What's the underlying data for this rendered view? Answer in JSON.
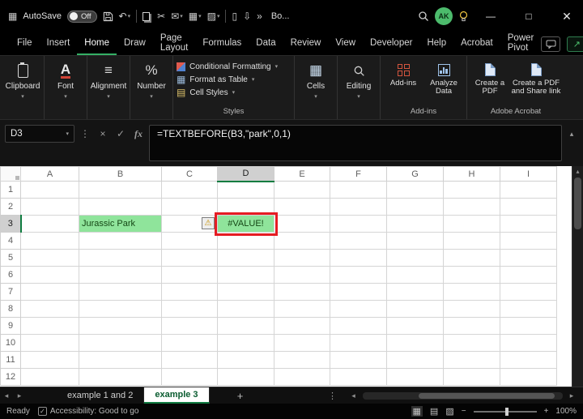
{
  "icons": {
    "chevron_down": "▾",
    "chevron_up": "▴",
    "menu_grid": "▦",
    "undo": "↶",
    "cut": "✂",
    "mail": "✉",
    "table": "▦",
    "fill": "▨",
    "doc": "▯",
    "download": "⇩",
    "overflow": "»",
    "ellipsis_v": "⋮",
    "cancel": "×",
    "check": "✓",
    "fx": "fx",
    "warning": "⚠",
    "alignment": "≡",
    "percent": "%",
    "font_a": "A",
    "cellstyles": "▤",
    "cells": "▦",
    "plus": "+",
    "minus": "−",
    "left_arrow": "◂",
    "right_arrow": "▸",
    "up_arrow": "▴",
    "view_normal": "▦",
    "view_layout": "▤",
    "view_break": "▨",
    "share_arrow": "↗",
    "minimize": "—",
    "maximize": "□",
    "close": "✕"
  },
  "titlebar": {
    "autosave_label": "AutoSave",
    "autosave_state": "Off",
    "workbook_name": "Bo...",
    "avatar_initials": "AK"
  },
  "menubar": {
    "items": [
      "File",
      "Insert",
      "Home",
      "Draw",
      "Page Layout",
      "Formulas",
      "Data",
      "Review",
      "View",
      "Developer",
      "Help",
      "Acrobat",
      "Power Pivot"
    ],
    "active": "Home"
  },
  "ribbon": {
    "collapsed_groups": [
      {
        "label": "Clipboard"
      },
      {
        "label": "Font"
      },
      {
        "label": "Alignment"
      },
      {
        "label": "Number"
      }
    ],
    "styles_group": {
      "label": "Styles",
      "items": [
        "Conditional Formatting",
        "Format as Table",
        "Cell Styles"
      ]
    },
    "cells_group": {
      "label": "Cells"
    },
    "editing_group": {
      "label": "Editing"
    },
    "addins_group": {
      "label": "Add-ins",
      "buttons": [
        "Add-ins",
        "Analyze Data"
      ]
    },
    "acrobat_group": {
      "label": "Adobe Acrobat",
      "buttons": [
        "Create a PDF",
        "Create a PDF and Share link"
      ]
    }
  },
  "formula_bar": {
    "name_box": "D3",
    "formula": "=TEXTBEFORE(B3,\"park\",0,1)"
  },
  "grid": {
    "columns": [
      "A",
      "B",
      "C",
      "D",
      "E",
      "F",
      "G",
      "H",
      "I"
    ],
    "rows": [
      "1",
      "2",
      "3",
      "4",
      "5",
      "6",
      "7",
      "8",
      "9",
      "10",
      "11",
      "12"
    ],
    "cells": {
      "B3": "Jurassic Park",
      "D3": "#VALUE!"
    },
    "fill_cells": [
      "B3",
      "D3"
    ],
    "selected_cell": "D3",
    "selected_col": "D",
    "selected_row": "3",
    "error_flag_cell": "C3"
  },
  "sheet_bar": {
    "tabs": [
      {
        "label": "example 1 and 2",
        "active": false
      },
      {
        "label": "example 3",
        "active": true
      }
    ],
    "add_tab": "+"
  },
  "status_bar": {
    "mode": "Ready",
    "accessibility": "Accessibility: Good to go",
    "zoom": "100%"
  }
}
